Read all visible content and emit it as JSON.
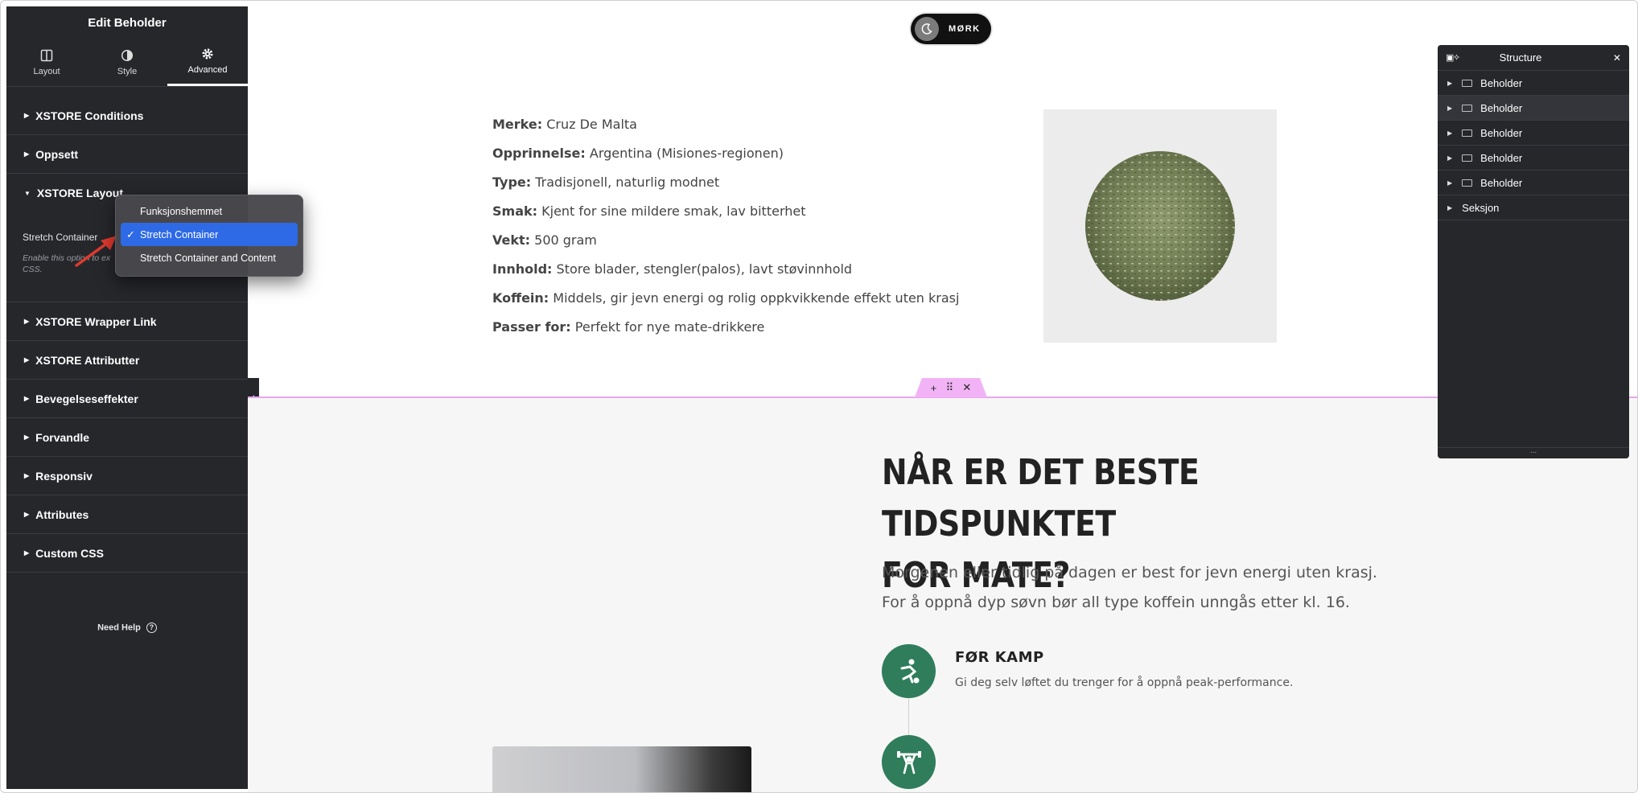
{
  "panel": {
    "title": "Edit Beholder",
    "tabs": [
      {
        "label": "Layout"
      },
      {
        "label": "Style"
      },
      {
        "label": "Advanced"
      }
    ],
    "sections": {
      "xstore_conditions": "XSTORE Conditions",
      "oppsett": "Oppsett",
      "xstore_layout": "XSTORE Layout",
      "wrapper_link": "XSTORE Wrapper Link",
      "attributter": "XSTORE Attributter",
      "bevegelse": "Bevegelseseffekter",
      "forvandle": "Forvandle",
      "responsiv": "Responsiv",
      "attributes": "Attributes",
      "custom_css": "Custom CSS"
    },
    "field_label": "Stretch Container",
    "field_desc_1": "Enable this option to ex",
    "field_desc_2": "CSS.",
    "need_help": "Need Help"
  },
  "dropdown": {
    "options": [
      "Funksjonshemmet",
      "Stretch Container",
      "Stretch Container and Content"
    ],
    "selected": "Stretch Container"
  },
  "canvas": {
    "toggle_label": "MØRK",
    "specs": [
      {
        "label": "Merke:",
        "value": "Cruz De Malta"
      },
      {
        "label": "Opprinnelse:",
        "value": "Argentina (Misiones-regionen)"
      },
      {
        "label": "Type:",
        "value": "Tradisjonell, naturlig modnet"
      },
      {
        "label": "Smak:",
        "value": "Kjent for sine mildere smak, lav bitterhet"
      },
      {
        "label": "Vekt:",
        "value": "500 gram"
      },
      {
        "label": "Innhold:",
        "value": "Store blader, stengler(palos), lavt støvinnhold"
      },
      {
        "label": "Koffein:",
        "value": "Middels, gir jevn energi og rolig oppkvikkende effekt uten krasj"
      },
      {
        "label": "Passer for:",
        "value": "Perfekt for nye mate-drikkere"
      }
    ],
    "heading_line1": "NÅR ER DET BESTE TIDSPUNKTET",
    "heading_line2": "FOR MATE?",
    "lead": "Morgenen eller tidlig på dagen er best for jevn energi uten krasj. For å oppnå dyp søvn bør all type koffein unngås etter kl. 16.",
    "feature_title": "FØR KAMP",
    "feature_desc": "Gi deg selv løftet du trenger for å oppnå peak-performance."
  },
  "structure": {
    "title": "Structure",
    "items": [
      {
        "label": "Beholder"
      },
      {
        "label": "Beholder"
      },
      {
        "label": "Beholder"
      },
      {
        "label": "Beholder"
      },
      {
        "label": "Beholder"
      },
      {
        "label": "Seksjon"
      }
    ],
    "footer": "..."
  },
  "colors": {
    "panel_bg": "#26272b",
    "accent_selected": "#2e6ae6",
    "feature_green": "#2f7d5b",
    "section_outline": "#e7a6ec"
  }
}
